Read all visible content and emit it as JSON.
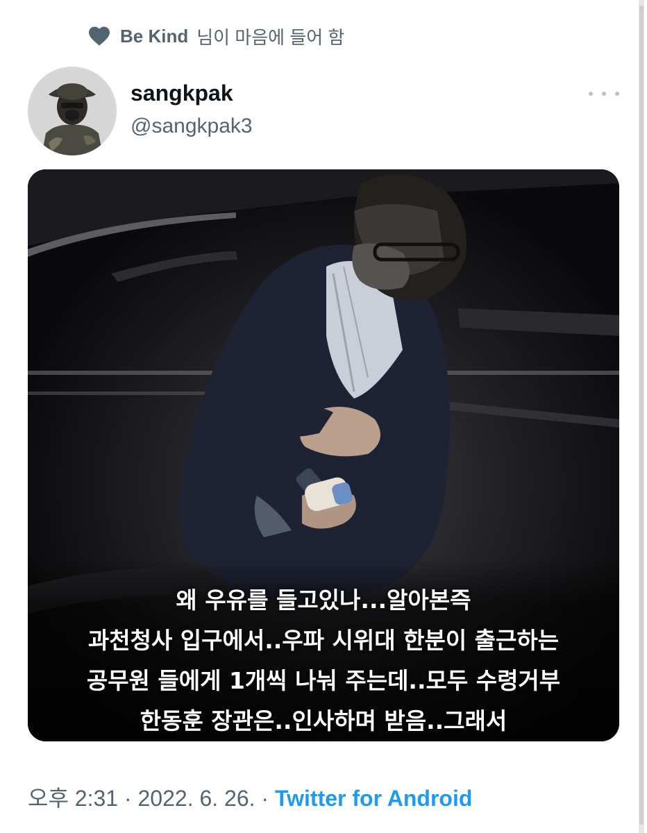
{
  "social_context": {
    "icon": "heart-icon",
    "liker_name": "Be Kind",
    "text": "님이 마음에 들어 함"
  },
  "author": {
    "display_name": "sangkpak",
    "handle": "@sangkpak3",
    "avatar": "avatar"
  },
  "media": {
    "caption_lines": [
      "왜 우유를 들고있나...알아본즉",
      "과천청사 입구에서..우파 시위대 한분이 출근하는",
      "공무원 들에게 1개씩 나눠 주는데..모두 수령거부",
      "한동훈 장관은..인사하며 받음..그래서"
    ]
  },
  "meta": {
    "time": "오후 2:31",
    "separator": "·",
    "date": "2022. 6. 26.",
    "source": "Twitter for Android"
  },
  "colors": {
    "secondary_text": "#536471",
    "link_blue": "#1d9bf0",
    "primary_text": "#0f1419"
  }
}
